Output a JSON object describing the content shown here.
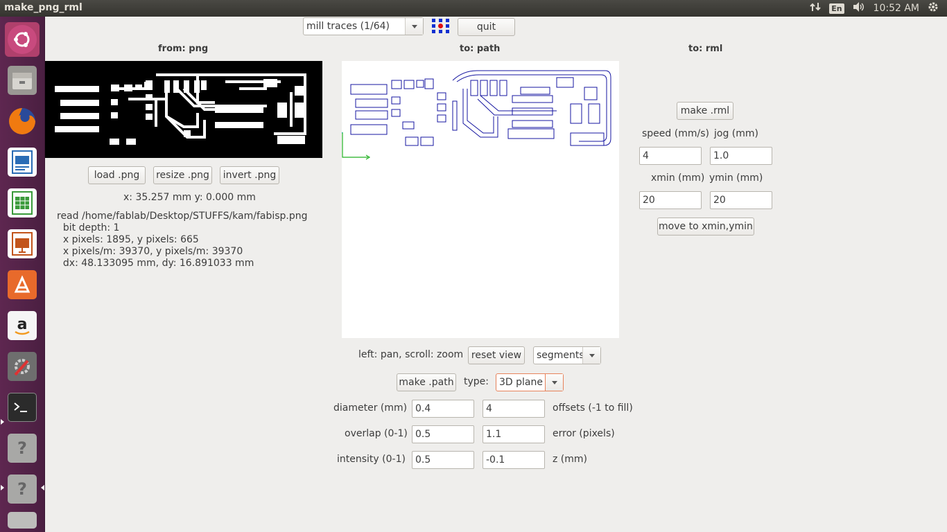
{
  "window": {
    "title": "make_png_rml"
  },
  "tray": {
    "lang": "En",
    "clock": "10:52 AM"
  },
  "launcher": [
    {
      "name": "ubuntu-dash-icon",
      "color": "#c84a7e"
    },
    {
      "name": "files-icon",
      "color": "#8a8a86"
    },
    {
      "name": "firefox-icon",
      "color": "#e66000"
    },
    {
      "name": "writer-icon",
      "color": "#2a6cb5"
    },
    {
      "name": "calc-icon",
      "color": "#3a9a3a"
    },
    {
      "name": "impress-icon",
      "color": "#c2541b"
    },
    {
      "name": "software-center-icon",
      "color": "#e86a2b"
    },
    {
      "name": "amazon-icon",
      "color": "#f5f5f5"
    },
    {
      "name": "system-settings-icon",
      "color": "#7a7a7a"
    },
    {
      "name": "terminal-icon",
      "color": "#2b2b2b"
    },
    {
      "name": "unknown-app-icon",
      "color": "#9a9a9a"
    },
    {
      "name": "unknown-app-icon",
      "color": "#9a9a9a"
    }
  ],
  "toolbar": {
    "mode_value": "mill traces (1/64)",
    "quit_label": "quit"
  },
  "from_panel": {
    "heading": "from: png",
    "load_label": "load .png",
    "resize_label": "resize .png",
    "invert_label": "invert .png",
    "coords": "x: 35.257 mm  y: 0.000 mm",
    "info_lines": [
      "read /home/fablab/Desktop/STUFFS/kam/fabisp.png",
      "  bit depth: 1",
      "  x pixels: 1895, y pixels: 665",
      "  x pixels/m: 39370, y pixels/m: 39370",
      "  dx: 48.133095 mm, dy: 16.891033 mm"
    ]
  },
  "path_panel": {
    "heading": "to: path",
    "hint": "left: pan, scroll: zoom",
    "reset_label": "reset view",
    "view_value": "segments",
    "make_path_label": "make .path",
    "type_label": "type:",
    "type_value": "3D plane",
    "diameter_label": "diameter (mm)",
    "diameter_value": "0.4",
    "offsets_value": "4",
    "offsets_label": "offsets (-1 to fill)",
    "overlap_label": "overlap (0-1)",
    "overlap_value": "0.5",
    "error_value": "1.1",
    "error_label": "error (pixels)",
    "intensity_label": "intensity (0-1)",
    "intensity_value": "0.5",
    "z_value": "-0.1",
    "z_label": "z (mm)"
  },
  "rml_panel": {
    "heading": "to: rml",
    "make_rml_label": "make .rml",
    "speed_label": "speed (mm/s)",
    "jog_label": "jog (mm)",
    "speed_value": "4",
    "jog_value": "1.0",
    "xmin_label": "xmin (mm)",
    "ymin_label": "ymin (mm)",
    "xmin_value": "20",
    "ymin_value": "20",
    "move_label": "move to xmin,ymin"
  }
}
